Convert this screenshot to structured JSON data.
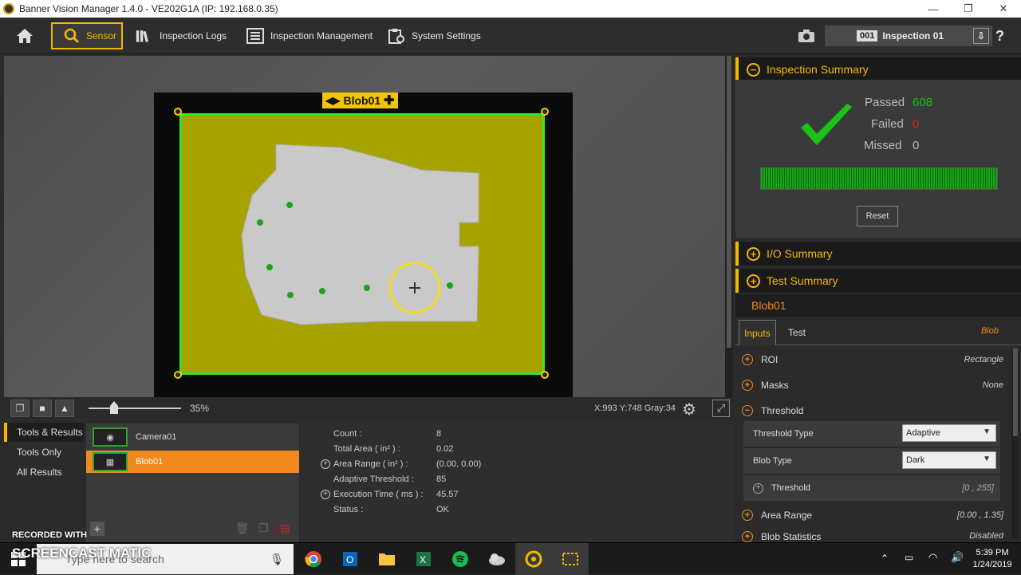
{
  "window": {
    "title": "Banner Vision Manager 1.4.0 - VE202G1A (IP: 192.168.0.35)",
    "minimize": "—",
    "maximize": "❐",
    "close": "✕"
  },
  "toolbar": {
    "sensor": "Sensor",
    "inspection_logs": "Inspection Logs",
    "inspection_management": "Inspection Management",
    "system_settings": "System Settings",
    "inspection_number": "001",
    "inspection_name": "Inspection 01",
    "help": "?"
  },
  "viewer": {
    "roi_label": "Blob01",
    "zoom": "35%",
    "coords": "X:993 Y:748 Gray:34"
  },
  "summary": {
    "title": "Inspection Summary",
    "passed_label": "Passed",
    "passed_value": "608",
    "failed_label": "Failed",
    "failed_value": "0",
    "missed_label": "Missed",
    "missed_value": "0",
    "reset": "Reset"
  },
  "io_summary": "I/O Summary",
  "test_summary": "Test Summary",
  "tool": {
    "name": "Blob01",
    "tab_inputs": "Inputs",
    "tab_test": "Test",
    "tool_type": "Blob",
    "params": [
      {
        "label": "ROI",
        "value": "Rectangle"
      },
      {
        "label": "Masks",
        "value": "None"
      },
      {
        "label": "Threshold",
        "value": ""
      },
      {
        "label": "Area Range",
        "value": "[0.00 , 1.35]"
      },
      {
        "label": "Blob Statistics",
        "value": "Disabled"
      }
    ],
    "threshold_type_label": "Threshold Type",
    "threshold_type_value": "Adaptive",
    "blob_type_label": "Blob Type",
    "blob_type_value": "Dark",
    "threshold_sub_label": "Threshold",
    "threshold_sub_value": "[0 , 255]"
  },
  "bottom": {
    "tabs": [
      "Tools & Results",
      "Tools Only",
      "All Results"
    ],
    "tools": [
      "Camera01",
      "Blob01"
    ],
    "add": "+",
    "results": [
      {
        "label": "Count :",
        "value": "8"
      },
      {
        "label": "Total Area ( in² ) :",
        "value": "0.02"
      },
      {
        "label": "Area Range ( in² ) :",
        "value": "(0.00, 0.00)"
      },
      {
        "label": "Adaptive Threshold :",
        "value": "85"
      },
      {
        "label": "Execution Time ( ms ) :",
        "value": "45.57"
      },
      {
        "label": "Status :",
        "value": "OK"
      }
    ]
  },
  "taskbar": {
    "search_placeholder": "Type here to search",
    "time": "5:39 PM",
    "date": "1/24/2019"
  },
  "watermark": {
    "line1": "RECORDED WITH",
    "line2": "SCREENCAST MATIC"
  },
  "colors": {
    "accent": "#f5b800",
    "orange": "#f08a1e",
    "pass_green": "#19c419",
    "fail_red": "#e02020",
    "roi_fill": "#a6a300",
    "roi_border": "#2ee62e"
  }
}
